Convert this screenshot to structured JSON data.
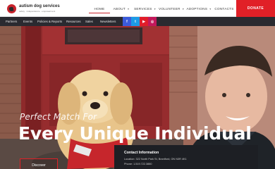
{
  "brand": {
    "name": "autism dog services",
    "tagline": "safety · independence · empowerment"
  },
  "nav": {
    "items": [
      {
        "label": "Home",
        "active": true,
        "dropdown": false
      },
      {
        "label": "About",
        "active": false,
        "dropdown": true
      },
      {
        "label": "Services",
        "active": false,
        "dropdown": true
      },
      {
        "label": "Volunteer",
        "active": false,
        "dropdown": true
      },
      {
        "label": "Adoptions",
        "active": false,
        "dropdown": true
      },
      {
        "label": "Contacts",
        "active": false,
        "dropdown": false
      }
    ],
    "donate_label": "Donate"
  },
  "subnav": {
    "items": [
      "Partners",
      "Events",
      "Policies & Reports",
      "Resources",
      "Sales",
      "Newsletters"
    ]
  },
  "social": [
    {
      "name": "facebook-icon",
      "glyph": "f",
      "color": "#3b5bdb"
    },
    {
      "name": "twitter-icon",
      "glyph": "t",
      "color": "#1c9be6"
    },
    {
      "name": "youtube-icon",
      "glyph": "▶",
      "color": "#e11d2a"
    },
    {
      "name": "instagram-icon",
      "glyph": "◎",
      "color": "#c2185b"
    }
  ],
  "hero": {
    "tagline": "Perfect Match For",
    "headline": "Every Unique Individual",
    "cta_label": "Discover"
  },
  "contact": {
    "title": "Contact Information",
    "location": "Location: 322 North Park St, Brantford, ON N3R 4K1",
    "phone": "Phone: 1.519.722.3880"
  },
  "colors": {
    "accent": "#e12027",
    "dark_bar": "#2a2a30"
  }
}
